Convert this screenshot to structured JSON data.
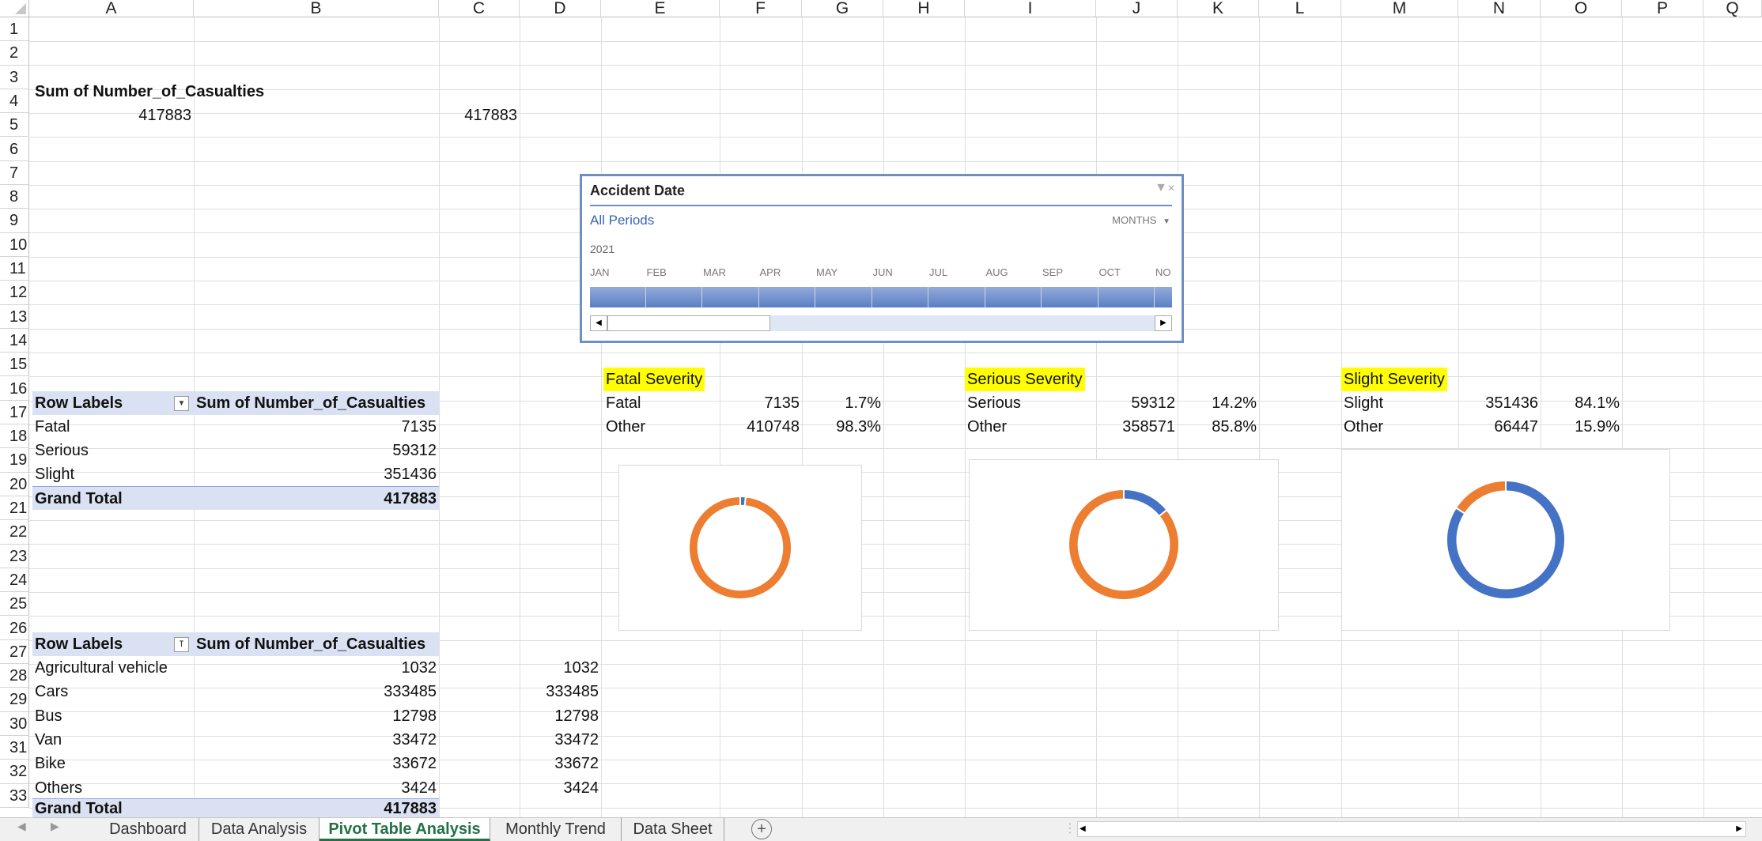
{
  "columns": [
    "A",
    "B",
    "C",
    "D",
    "E",
    "F",
    "G",
    "H",
    "I",
    "J",
    "K",
    "L",
    "M",
    "N",
    "O",
    "P",
    "Q"
  ],
  "rows": [
    "1",
    "2",
    "3",
    "4",
    "5",
    "6",
    "7",
    "8",
    "9",
    "10",
    "11",
    "12",
    "13",
    "14",
    "15",
    "16",
    "17",
    "18",
    "19",
    "20",
    "21",
    "22",
    "23",
    "24",
    "25",
    "26",
    "27",
    "28",
    "29",
    "30",
    "31",
    "32",
    "33"
  ],
  "top_pivot": {
    "header": "Sum of Number_of_Casualties",
    "value": "417883",
    "value_c": "417883"
  },
  "severity_pivot": {
    "row_labels": "Row Labels",
    "sum_header": "Sum of Number_of_Casualties",
    "rows": [
      {
        "label": "Fatal",
        "value": "7135"
      },
      {
        "label": "Serious",
        "value": "59312"
      },
      {
        "label": "Slight",
        "value": "351436"
      }
    ],
    "grand_total_label": "Grand Total",
    "grand_total": "417883"
  },
  "vehicle_pivot": {
    "row_labels": "Row Labels",
    "sum_header": "Sum of Number_of_Casualties",
    "rows": [
      {
        "label": "Agricultural vehicle",
        "value": "1032",
        "d": "1032"
      },
      {
        "label": "Cars",
        "value": "333485",
        "d": "333485"
      },
      {
        "label": "Bus",
        "value": "12798",
        "d": "12798"
      },
      {
        "label": "Van",
        "value": "33472",
        "d": "33472"
      },
      {
        "label": "Bike",
        "value": "33672",
        "d": "33672"
      },
      {
        "label": "Others",
        "value": "3424",
        "d": "3424"
      }
    ],
    "grand_total_label": "Grand Total",
    "grand_total": "417883"
  },
  "severity_tables": {
    "fatal": {
      "title": "Fatal Severity",
      "label1": "Fatal",
      "value1": "7135",
      "pct1": "1.7%",
      "label2": "Other",
      "value2": "410748",
      "pct2": "98.3%"
    },
    "serious": {
      "title": "Serious Severity",
      "label1": "Serious",
      "value1": "59312",
      "pct1": "14.2%",
      "label2": "Other",
      "value2": "358571",
      "pct2": "85.8%"
    },
    "slight": {
      "title": "Slight Severity",
      "label1": "Slight",
      "value1": "351436",
      "pct1": "84.1%",
      "label2": "Other",
      "value2": "66447",
      "pct2": "15.9%"
    }
  },
  "slicer": {
    "title": "Accident Date",
    "period": "All Periods",
    "level": "MONTHS",
    "year": "2021",
    "months": [
      "JAN",
      "FEB",
      "MAR",
      "APR",
      "MAY",
      "JUN",
      "JUL",
      "AUG",
      "SEP",
      "OCT",
      "NO"
    ]
  },
  "chart_data": [
    {
      "type": "pie",
      "hole": true,
      "labels": [
        "Fatal",
        "Other"
      ],
      "values": [
        1.7,
        98.3
      ],
      "colors": [
        "#4472c4",
        "#ed7d31"
      ]
    },
    {
      "type": "pie",
      "hole": true,
      "labels": [
        "Serious",
        "Other"
      ],
      "values": [
        14.2,
        85.8
      ],
      "colors": [
        "#4472c4",
        "#ed7d31"
      ]
    },
    {
      "type": "pie",
      "hole": true,
      "labels": [
        "Slight",
        "Other"
      ],
      "values": [
        84.1,
        15.9
      ],
      "colors": [
        "#4472c4",
        "#ed7d31"
      ]
    }
  ],
  "tabs": [
    {
      "label": "Dashboard",
      "active": false
    },
    {
      "label": "Data Analysis",
      "active": false
    },
    {
      "label": "Pivot Table Analysis",
      "active": true
    },
    {
      "label": "Monthly Trend",
      "active": false
    },
    {
      "label": "Data Sheet",
      "active": false
    }
  ],
  "colors": {
    "pivot_header": "#d9e1f2",
    "highlight": "#ffff00",
    "blue": "#4472c4",
    "orange": "#ed7d31",
    "tab_active": "#217346"
  }
}
